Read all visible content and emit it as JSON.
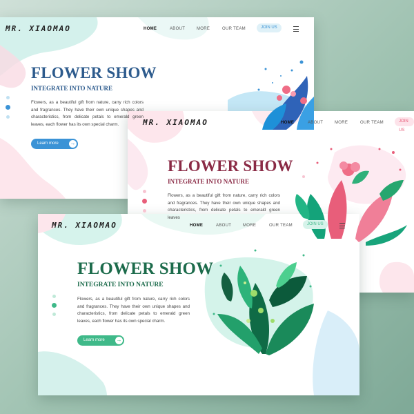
{
  "colors": {
    "blue": "#2d5b8d",
    "maroon": "#8a2a45",
    "green": "#1c6b4b",
    "green_button": "#3fb989",
    "blue_button": "#3b93d6",
    "pink_accent": "#e85e7a"
  },
  "cards": {
    "blue": {
      "logo": "MR. XIAOMAO",
      "nav": [
        "HOME",
        "ABOUT",
        "MORE",
        "OUR TEAM"
      ],
      "join": "JOIN US",
      "title": "FLOWER SHOW",
      "subtitle": "INTEGRATE INTO NATURE",
      "body": "Flowers, as a beautiful gift from nature, carry rich colors and fragrances. They have their own unique shapes and characteristics, from delicate petals to emerald green leaves, each flower has its own special charm.",
      "button": "Learn more"
    },
    "pink": {
      "logo": "MR. XIAOMAO",
      "nav": [
        "HOME",
        "ABOUT",
        "MORE",
        "OUR TEAM"
      ],
      "join": "JOIN US",
      "title": "FLOWER SHOW",
      "subtitle": "INTEGRATE INTO NATURE",
      "body": "Flowers, as a beautiful gift from nature, carry rich colors and fragrances. They have their own unique shapes and characteristics, from delicate petals to emerald green leaves"
    },
    "green": {
      "logo": "MR. XIAOMAO",
      "nav": [
        "HOME",
        "ABOUT",
        "MORE",
        "OUR TEAM"
      ],
      "join": "JOIN US",
      "title": "FLOWER SHOW",
      "subtitle": "INTEGRATE INTO NATURE",
      "body": "Flowers, as a beautiful gift from nature, carry rich colors and fragrances. They have their own unique shapes and characteristics, from delicate petals to emerald green leaves, each flower has its own special charm.",
      "button": "Learn more"
    }
  },
  "icons": {
    "arrow": "arrow-right-icon",
    "menu": "hamburger-menu-icon"
  }
}
